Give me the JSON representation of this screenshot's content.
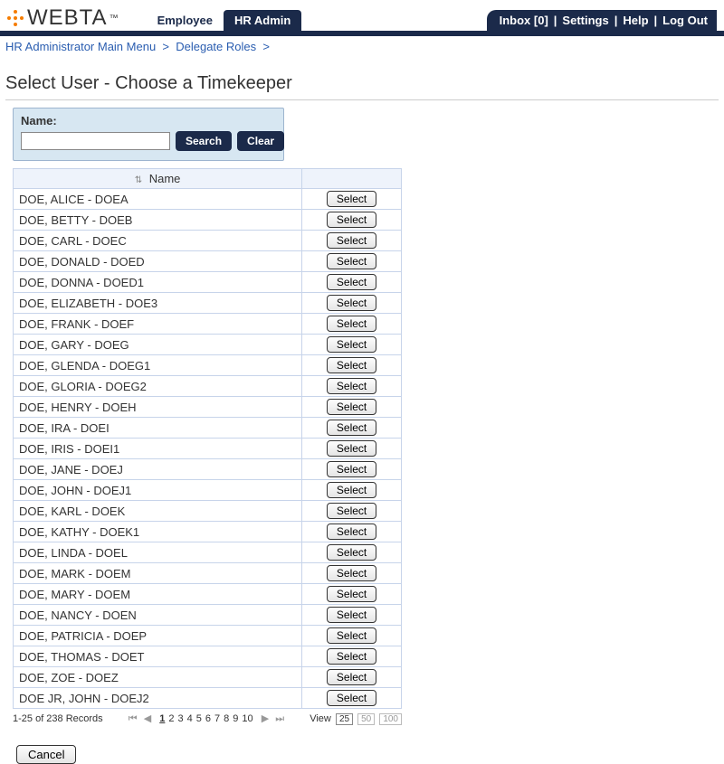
{
  "brand": {
    "name": "WEBTA",
    "tm": "™"
  },
  "nav": {
    "employee": "Employee",
    "hr_admin": "HR Admin"
  },
  "top_links": {
    "inbox_label": "Inbox [0]",
    "settings": "Settings",
    "help": "Help",
    "logout": "Log Out"
  },
  "breadcrumbs": {
    "item1": "HR Administrator Main Menu",
    "item2": "Delegate Roles",
    "sep": ">"
  },
  "page_title": "Select User - Choose a Timekeeper",
  "search": {
    "label": "Name:",
    "value": "",
    "search_btn": "Search",
    "clear_btn": "Clear"
  },
  "table": {
    "header_name": "Name",
    "select_label": "Select",
    "rows": [
      "DOE, ALICE - DOEA",
      "DOE, BETTY - DOEB",
      "DOE, CARL - DOEC",
      "DOE, DONALD - DOED",
      "DOE, DONNA - DOED1",
      "DOE, ELIZABETH - DOE3",
      "DOE, FRANK - DOEF",
      "DOE, GARY - DOEG",
      "DOE, GLENDA - DOEG1",
      "DOE, GLORIA - DOEG2",
      "DOE, HENRY - DOEH",
      "DOE, IRA - DOEI",
      "DOE, IRIS - DOEI1",
      "DOE, JANE - DOEJ",
      "DOE, JOHN - DOEJ1",
      "DOE, KARL - DOEK",
      "DOE, KATHY - DOEK1",
      "DOE, LINDA - DOEL",
      "DOE, MARK - DOEM",
      "DOE, MARY - DOEM",
      "DOE, NANCY - DOEN",
      "DOE, PATRICIA - DOEP",
      "DOE, THOMAS - DOET",
      "DOE, ZOE - DOEZ",
      "DOE JR, JOHN - DOEJ2"
    ]
  },
  "pager": {
    "info": "1-25 of 238 Records",
    "pages": [
      "1",
      "2",
      "3",
      "4",
      "5",
      "6",
      "7",
      "8",
      "9",
      "10"
    ],
    "current": "1",
    "view_label": "View",
    "views": [
      "25",
      "50",
      "100"
    ],
    "view_active": "25"
  },
  "cancel": "Cancel"
}
